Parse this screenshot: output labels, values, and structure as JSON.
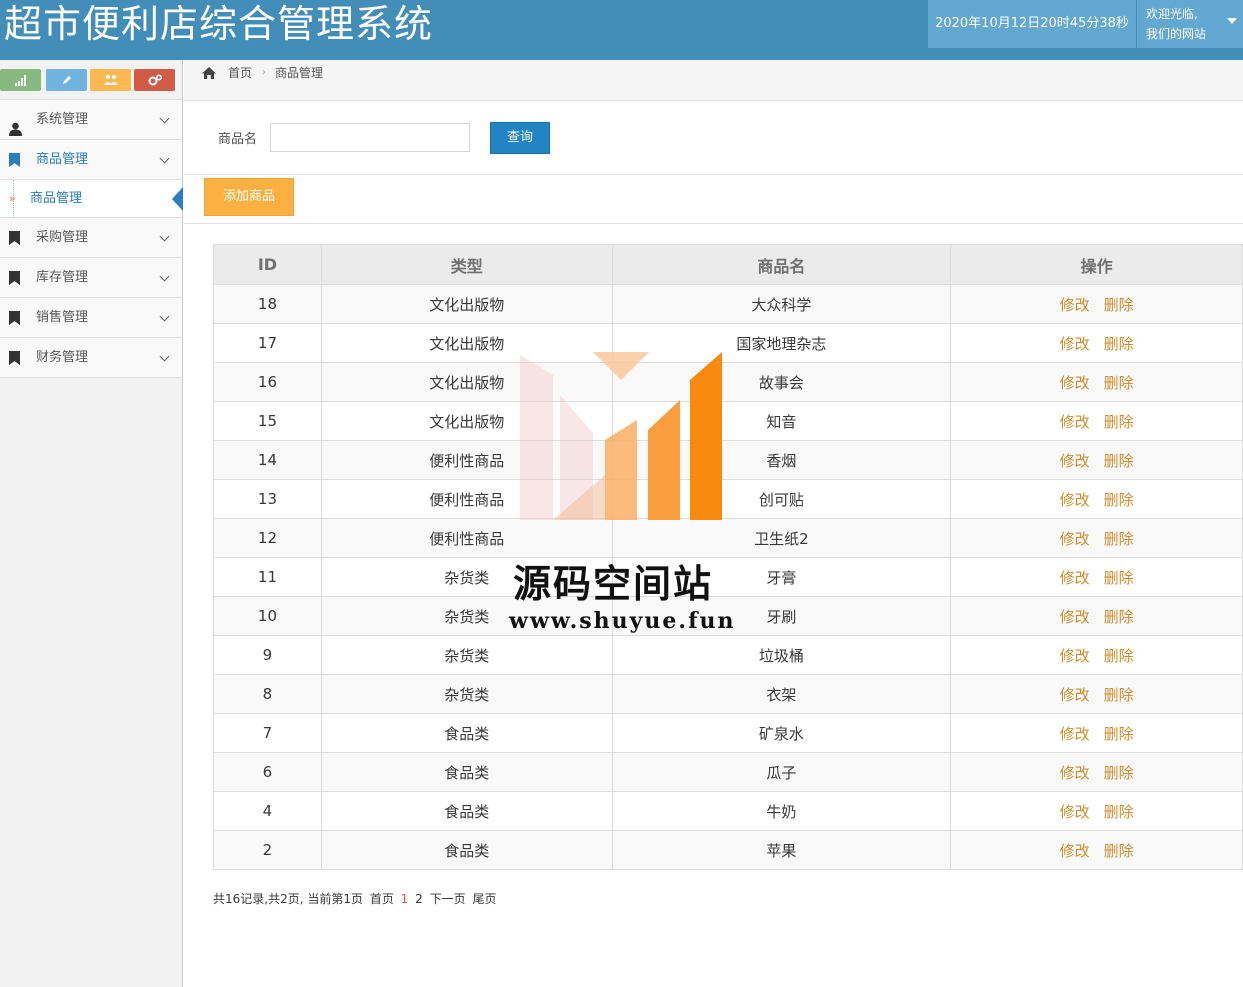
{
  "header": {
    "title": "超市便利店综合管理系统",
    "datetime": "2020年10月12日20时45分38秒",
    "welcome_line1": "欢迎光临,",
    "welcome_line2": "我们的网站"
  },
  "sidebar": {
    "shortcuts": [
      {
        "icon": "signal-icon",
        "color": "#87b87f"
      },
      {
        "icon": "pencil-icon",
        "color": "#6fb3e0"
      },
      {
        "icon": "users-icon",
        "color": "#ffb752"
      },
      {
        "icon": "cogs-icon",
        "color": "#d15b47"
      }
    ],
    "items": [
      {
        "label": "系统管理",
        "icon": "user-icon"
      },
      {
        "label": "商品管理",
        "icon": "bookmark-icon"
      },
      {
        "label": "采购管理",
        "icon": "bookmark-icon"
      },
      {
        "label": "库存管理",
        "icon": "bookmark-icon"
      },
      {
        "label": "销售管理",
        "icon": "bookmark-icon"
      },
      {
        "label": "财务管理",
        "icon": "bookmark-icon"
      }
    ],
    "sub_item": {
      "label": "商品管理"
    }
  },
  "breadcrumb": {
    "home": "首页",
    "current": "商品管理"
  },
  "search": {
    "label": "商品名",
    "value": "",
    "placeholder": "",
    "button": "查询"
  },
  "add_button": "添加商品",
  "table": {
    "headers": [
      "ID",
      "类型",
      "商品名",
      "操作"
    ],
    "edit_label": "修改",
    "delete_label": "删除",
    "rows": [
      {
        "id": "18",
        "type": "文化出版物",
        "name": "大众科学"
      },
      {
        "id": "17",
        "type": "文化出版物",
        "name": "国家地理杂志"
      },
      {
        "id": "16",
        "type": "文化出版物",
        "name": "故事会"
      },
      {
        "id": "15",
        "type": "文化出版物",
        "name": "知音"
      },
      {
        "id": "14",
        "type": "便利性商品",
        "name": "香烟"
      },
      {
        "id": "13",
        "type": "便利性商品",
        "name": "创可贴"
      },
      {
        "id": "12",
        "type": "便利性商品",
        "name": "卫生纸2"
      },
      {
        "id": "11",
        "type": "杂货类",
        "name": "牙膏"
      },
      {
        "id": "10",
        "type": "杂货类",
        "name": "牙刷"
      },
      {
        "id": "9",
        "type": "杂货类",
        "name": "垃圾桶"
      },
      {
        "id": "8",
        "type": "杂货类",
        "name": "衣架"
      },
      {
        "id": "7",
        "type": "食品类",
        "name": "矿泉水"
      },
      {
        "id": "6",
        "type": "食品类",
        "name": "瓜子"
      },
      {
        "id": "4",
        "type": "食品类",
        "name": "牛奶"
      },
      {
        "id": "2",
        "type": "食品类",
        "name": "苹果"
      }
    ]
  },
  "pager": {
    "summary": "共16记录,共2页, 当前第1页",
    "first": "首页",
    "page1": "1",
    "page2": "2",
    "next": "下一页",
    "last": "尾页"
  },
  "watermark": {
    "title": "源码空间站",
    "url": "www.shuyue.fun"
  }
}
